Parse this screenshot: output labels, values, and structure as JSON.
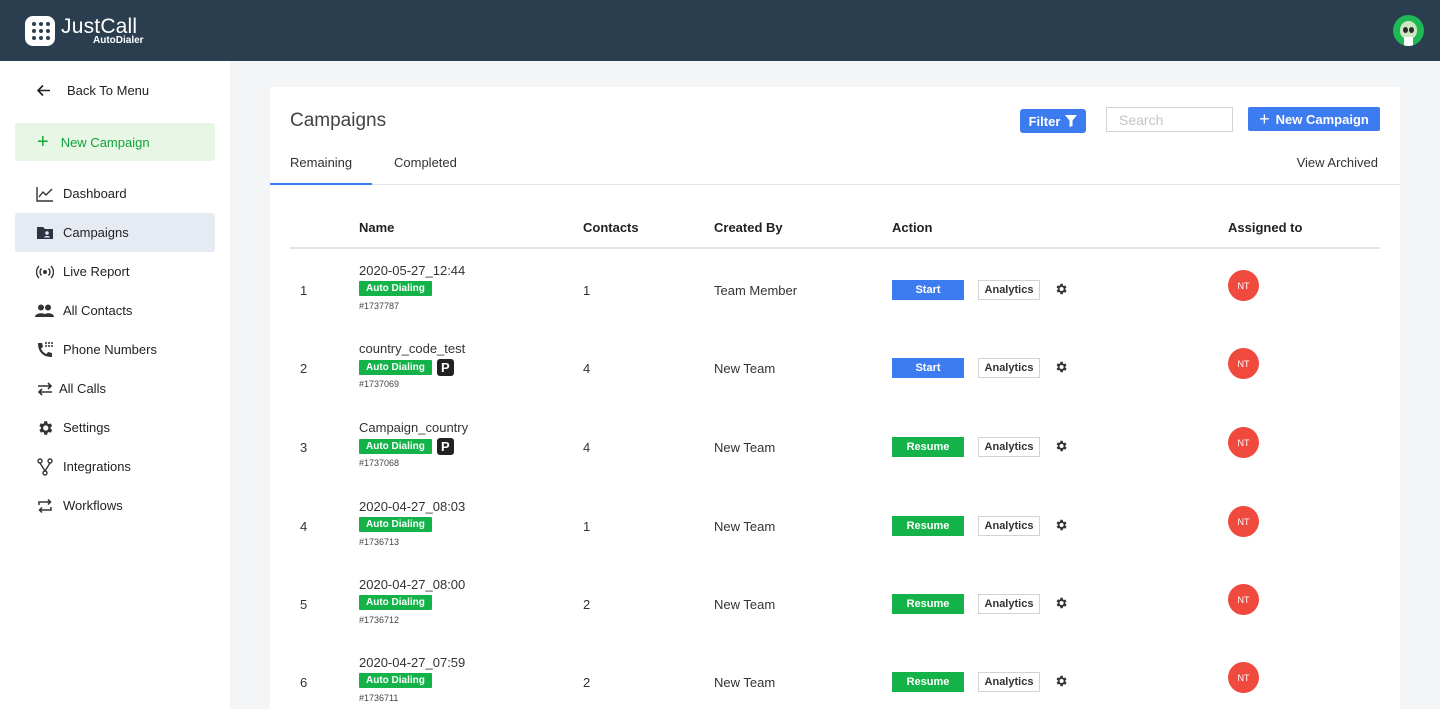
{
  "topbar": {
    "logo_title": "JustCall",
    "logo_subtitle": "AutoDialer"
  },
  "sidebar": {
    "back_label": "Back To Menu",
    "new_campaign_label": "New Campaign",
    "items": [
      {
        "label": "Dashboard",
        "icon": "line-chart-icon"
      },
      {
        "label": "Campaigns",
        "icon": "folder-user-icon",
        "active": true
      },
      {
        "label": "Live Report",
        "icon": "broadcast-icon"
      },
      {
        "label": "All Contacts",
        "icon": "people-icon"
      },
      {
        "label": "Phone Numbers",
        "icon": "phone-dialpad-icon"
      },
      {
        "label": "All Calls",
        "icon": "swap-arrows-icon"
      },
      {
        "label": "Settings",
        "icon": "gear-icon"
      },
      {
        "label": "Integrations",
        "icon": "fork-icon"
      },
      {
        "label": "Workflows",
        "icon": "repeat-icon"
      }
    ]
  },
  "main": {
    "title": "Campaigns",
    "filter_label": "Filter",
    "search_placeholder": "Search",
    "new_campaign_label": "New Campaign",
    "tabs": [
      {
        "label": "Remaining",
        "active": true
      },
      {
        "label": "Completed",
        "active": false
      }
    ],
    "view_archived_label": "View Archived",
    "columns": [
      "Name",
      "Contacts",
      "Created By",
      "Action",
      "Assigned to"
    ],
    "rows": [
      {
        "index": "1",
        "name": "2020-05-27_12:44",
        "tag": "Auto Dialing",
        "has_p_badge": false,
        "p_label": "",
        "id": "#1737787",
        "contacts": "1",
        "created_by": "Team Member",
        "action": "Start",
        "analytics": "Analytics",
        "assignee": "NT"
      },
      {
        "index": "2",
        "name": "country_code_test",
        "tag": "Auto Dialing",
        "has_p_badge": true,
        "p_label": "P",
        "id": "#1737069",
        "contacts": "4",
        "created_by": "New Team",
        "action": "Start",
        "analytics": "Analytics",
        "assignee": "NT"
      },
      {
        "index": "3",
        "name": "Campaign_country",
        "tag": "Auto Dialing",
        "has_p_badge": true,
        "p_label": "P",
        "id": "#1737068",
        "contacts": "4",
        "created_by": "New Team",
        "action": "Resume",
        "analytics": "Analytics",
        "assignee": "NT"
      },
      {
        "index": "4",
        "name": "2020-04-27_08:03",
        "tag": "Auto Dialing",
        "has_p_badge": false,
        "p_label": "",
        "id": "#1736713",
        "contacts": "1",
        "created_by": "New Team",
        "action": "Resume",
        "analytics": "Analytics",
        "assignee": "NT"
      },
      {
        "index": "5",
        "name": "2020-04-27_08:00",
        "tag": "Auto Dialing",
        "has_p_badge": false,
        "p_label": "",
        "id": "#1736712",
        "contacts": "2",
        "created_by": "New Team",
        "action": "Resume",
        "analytics": "Analytics",
        "assignee": "NT"
      },
      {
        "index": "6",
        "name": "2020-04-27_07:59",
        "tag": "Auto Dialing",
        "has_p_badge": false,
        "p_label": "",
        "id": "#1736711",
        "contacts": "2",
        "created_by": "New Team",
        "action": "Resume",
        "analytics": "Analytics",
        "assignee": "NT"
      }
    ]
  },
  "colors": {
    "topbar": "#2b3e50",
    "primary_blue": "#3d7cf0",
    "green": "#14b34a",
    "assignee_red": "#f04a3e"
  }
}
